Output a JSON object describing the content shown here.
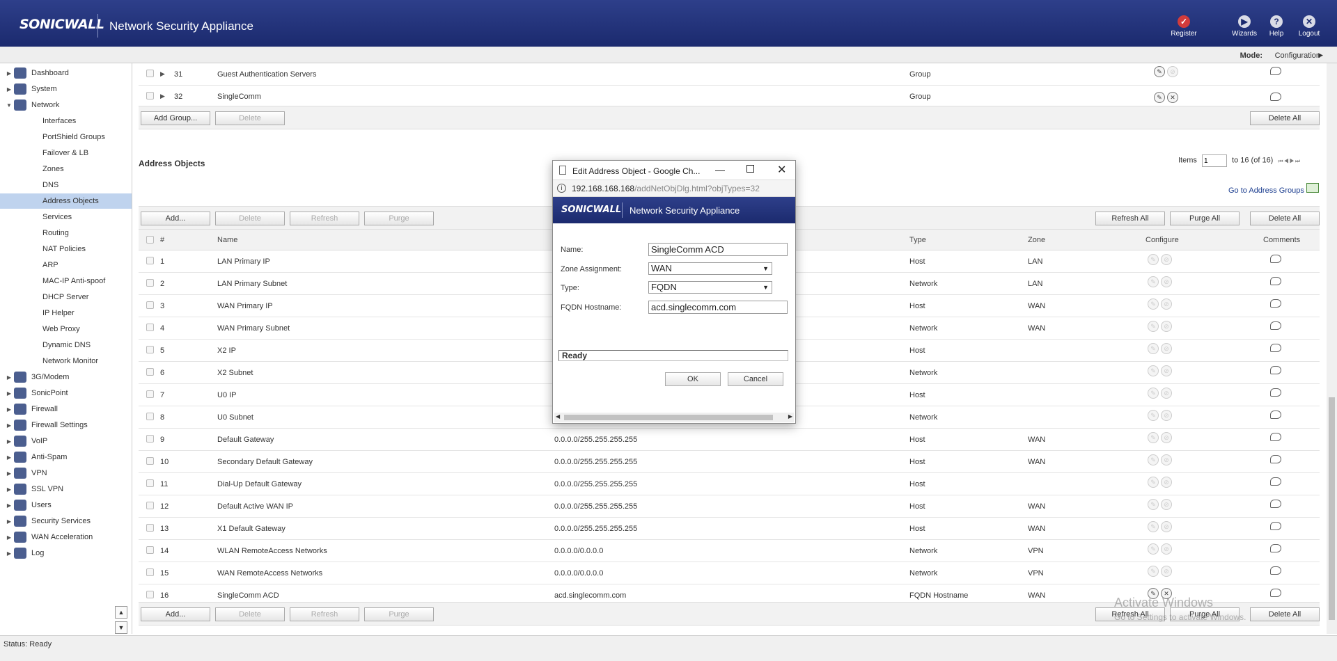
{
  "header": {
    "logo": "SONICWALL",
    "title": "Network Security Appliance",
    "buttons": [
      {
        "label": "Register",
        "icon": "register-icon"
      },
      {
        "label": "Wizards",
        "icon": "wizards-icon"
      },
      {
        "label": "Help",
        "icon": "help-icon"
      },
      {
        "label": "Logout",
        "icon": "logout-icon"
      }
    ]
  },
  "mode": {
    "label": "Mode:",
    "value": "Configuration"
  },
  "sidebar": {
    "items": [
      {
        "label": "Dashboard",
        "type": "top"
      },
      {
        "label": "System",
        "type": "top"
      },
      {
        "label": "Network",
        "type": "top",
        "expanded": true
      },
      {
        "label": "Interfaces",
        "type": "sub"
      },
      {
        "label": "PortShield Groups",
        "type": "sub"
      },
      {
        "label": "Failover & LB",
        "type": "sub"
      },
      {
        "label": "Zones",
        "type": "sub"
      },
      {
        "label": "DNS",
        "type": "sub"
      },
      {
        "label": "Address Objects",
        "type": "sub",
        "selected": true
      },
      {
        "label": "Services",
        "type": "sub"
      },
      {
        "label": "Routing",
        "type": "sub"
      },
      {
        "label": "NAT Policies",
        "type": "sub"
      },
      {
        "label": "ARP",
        "type": "sub"
      },
      {
        "label": "MAC-IP Anti-spoof",
        "type": "sub"
      },
      {
        "label": "DHCP Server",
        "type": "sub"
      },
      {
        "label": "IP Helper",
        "type": "sub"
      },
      {
        "label": "Web Proxy",
        "type": "sub"
      },
      {
        "label": "Dynamic DNS",
        "type": "sub"
      },
      {
        "label": "Network Monitor",
        "type": "sub"
      },
      {
        "label": "3G/Modem",
        "type": "top"
      },
      {
        "label": "SonicPoint",
        "type": "top"
      },
      {
        "label": "Firewall",
        "type": "top"
      },
      {
        "label": "Firewall Settings",
        "type": "top"
      },
      {
        "label": "VoIP",
        "type": "top"
      },
      {
        "label": "Anti-Spam",
        "type": "top"
      },
      {
        "label": "VPN",
        "type": "top"
      },
      {
        "label": "SSL VPN",
        "type": "top"
      },
      {
        "label": "Users",
        "type": "top"
      },
      {
        "label": "Security Services",
        "type": "top"
      },
      {
        "label": "WAN Acceleration",
        "type": "top"
      },
      {
        "label": "Log",
        "type": "top"
      }
    ]
  },
  "groups": {
    "rows": [
      {
        "num": "31",
        "name": "Guest Authentication Servers",
        "type": "Group"
      },
      {
        "num": "32",
        "name": "SingleComm",
        "type": "Group"
      }
    ],
    "buttons": {
      "add": "Add Group...",
      "delete": "Delete",
      "delete_all": "Delete All"
    }
  },
  "objects": {
    "title": "Address Objects",
    "items_label": "Items",
    "items_value": "1",
    "items_range": "to 16 (of 16)",
    "goto": "Go to Address Groups",
    "buttons": {
      "add": "Add...",
      "delete": "Delete",
      "refresh": "Refresh",
      "purge": "Purge",
      "refresh_all": "Refresh All",
      "purge_all": "Purge All",
      "delete_all": "Delete All"
    },
    "columns": {
      "num": "#",
      "name": "Name",
      "type": "Type",
      "zone": "Zone",
      "configure": "Configure",
      "comments": "Comments"
    },
    "rows": [
      {
        "num": "1",
        "name": "LAN Primary IP",
        "details": "",
        "type": "Host",
        "zone": "LAN"
      },
      {
        "num": "2",
        "name": "LAN Primary Subnet",
        "details": "",
        "type": "Network",
        "zone": "LAN"
      },
      {
        "num": "3",
        "name": "WAN Primary IP",
        "details": "",
        "type": "Host",
        "zone": "WAN"
      },
      {
        "num": "4",
        "name": "WAN Primary Subnet",
        "details": "",
        "type": "Network",
        "zone": "WAN"
      },
      {
        "num": "5",
        "name": "X2 IP",
        "details": "",
        "type": "Host",
        "zone": ""
      },
      {
        "num": "6",
        "name": "X2 Subnet",
        "details": "",
        "type": "Network",
        "zone": ""
      },
      {
        "num": "7",
        "name": "U0 IP",
        "details": "",
        "type": "Host",
        "zone": ""
      },
      {
        "num": "8",
        "name": "U0 Subnet",
        "details": "",
        "type": "Network",
        "zone": ""
      },
      {
        "num": "9",
        "name": "Default Gateway",
        "details": "0.0.0.0/255.255.255.255",
        "type": "Host",
        "zone": "WAN"
      },
      {
        "num": "10",
        "name": "Secondary Default Gateway",
        "details": "0.0.0.0/255.255.255.255",
        "type": "Host",
        "zone": "WAN"
      },
      {
        "num": "11",
        "name": "Dial-Up Default Gateway",
        "details": "0.0.0.0/255.255.255.255",
        "type": "Host",
        "zone": ""
      },
      {
        "num": "12",
        "name": "Default Active WAN IP",
        "details": "0.0.0.0/255.255.255.255",
        "type": "Host",
        "zone": "WAN"
      },
      {
        "num": "13",
        "name": "X1 Default Gateway",
        "details": "0.0.0.0/255.255.255.255",
        "type": "Host",
        "zone": "WAN"
      },
      {
        "num": "14",
        "name": "WLAN RemoteAccess Networks",
        "details": "0.0.0.0/0.0.0.0",
        "type": "Network",
        "zone": "VPN"
      },
      {
        "num": "15",
        "name": "WAN RemoteAccess Networks",
        "details": "0.0.0.0/0.0.0.0",
        "type": "Network",
        "zone": "VPN"
      },
      {
        "num": "16",
        "name": "SingleComm ACD",
        "details": "acd.singlecomm.com",
        "type": "FQDN Hostname",
        "zone": "WAN"
      }
    ]
  },
  "dialog": {
    "window_title": "Edit Address Object - Google Ch...",
    "url_host": "192.168.168.168",
    "url_path": "/addNetObjDlg.html?objTypes=32",
    "banner_logo": "SONICWALL",
    "banner_title": "Network Security Appliance",
    "name_label": "Name:",
    "name_value": "SingleComm ACD",
    "zone_label": "Zone Assignment:",
    "zone_value": "WAN",
    "type_label": "Type:",
    "type_value": "FQDN",
    "fqdn_label": "FQDN Hostname:",
    "fqdn_value": "acd.singlecomm.com",
    "status": "Ready",
    "ok": "OK",
    "cancel": "Cancel"
  },
  "status": {
    "text": "Status: Ready"
  },
  "watermark": {
    "line1": "Activate Windows",
    "line2": "Go to Settings to activate Windows."
  }
}
